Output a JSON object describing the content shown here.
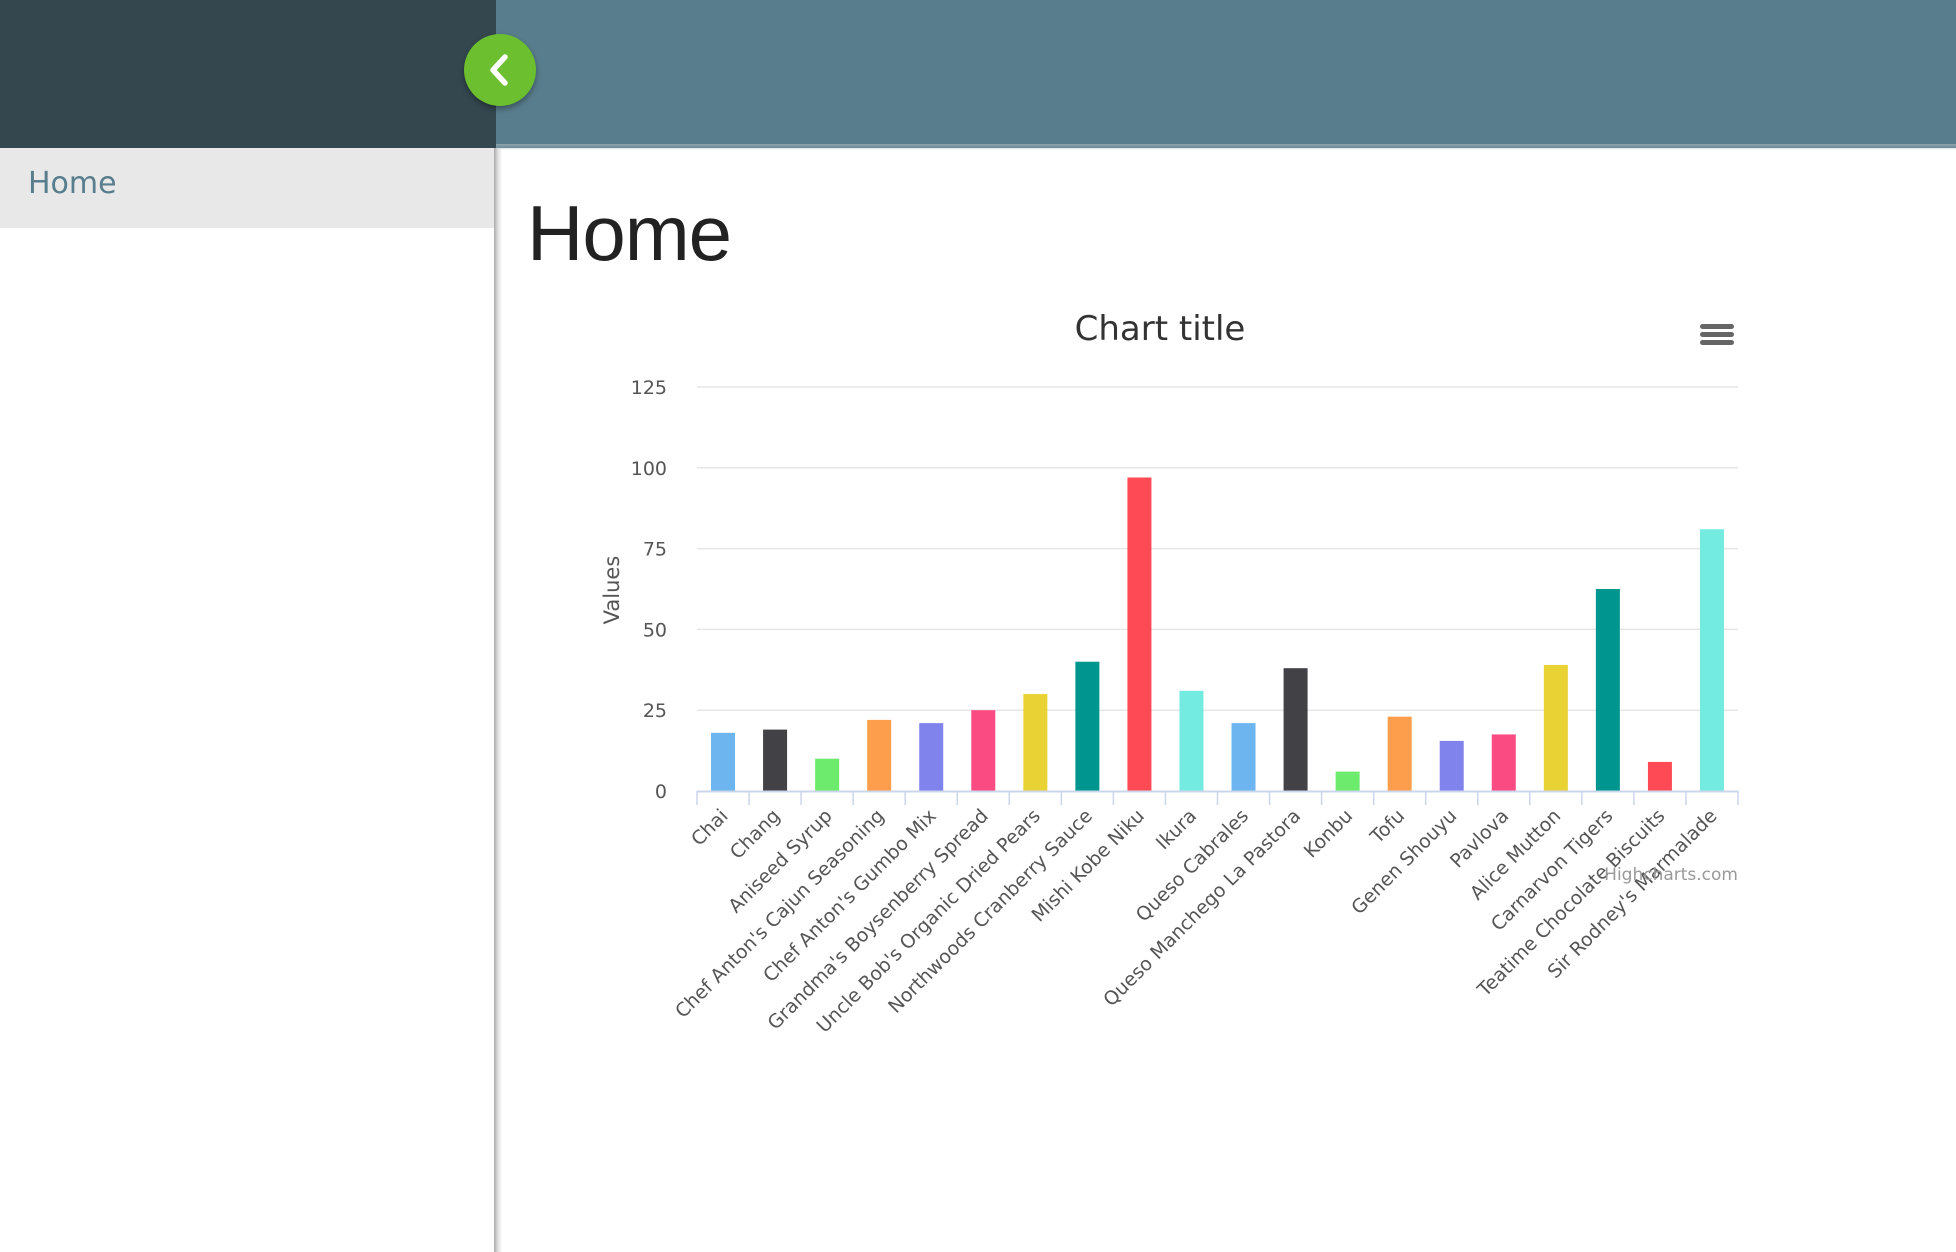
{
  "sidebar": {
    "items": [
      {
        "label": "Home"
      }
    ],
    "toggle_icon": "chevron-left-icon"
  },
  "colors": {
    "sidebar_header": "#34474f",
    "topbar": "#587d8c",
    "toggle_button": "#6cbf2f",
    "nav_active_bg": "#e8e8e8"
  },
  "main": {
    "title": "Home"
  },
  "chart_menu_icon": "hamburger-menu-icon",
  "chart_data": {
    "type": "bar",
    "title": "Chart title",
    "ylabel": "Values",
    "xlabel": "",
    "ylim": [
      0,
      125
    ],
    "yticks": [
      0,
      25,
      50,
      75,
      100,
      125
    ],
    "grid": true,
    "credits": "Highcharts.com",
    "categories": [
      "Chai",
      "Chang",
      "Aniseed Syrup",
      "Chef Anton's Cajun Seasoning",
      "Chef Anton's Gumbo Mix",
      "Grandma's Boysenberry Spread",
      "Uncle Bob's Organic Dried Pears",
      "Northwoods Cranberry Sauce",
      "Mishi Kobe Niku",
      "Ikura",
      "Queso Cabrales",
      "Queso Manchego La Pastora",
      "Konbu",
      "Tofu",
      "Genen Shouyu",
      "Pavlova",
      "Alice Mutton",
      "Carnarvon Tigers",
      "Teatime Chocolate Biscuits",
      "Sir Rodney's Marmalade"
    ],
    "values": [
      18,
      19,
      10,
      22,
      21,
      25,
      30,
      40,
      97,
      31,
      21,
      38,
      6,
      23,
      15.5,
      17.5,
      39,
      62.5,
      9,
      81
    ],
    "colors": [
      "#6db5ee",
      "#414146",
      "#6ceb6c",
      "#fd9e4c",
      "#8183ed",
      "#fb4b83",
      "#e9d233",
      "#009690",
      "#fe4a55",
      "#74ebe1",
      "#6db5ee",
      "#414146",
      "#6ceb6c",
      "#fd9e4c",
      "#8183ed",
      "#fb4b83",
      "#e9d233",
      "#009690",
      "#fe4a55",
      "#74ebe1"
    ]
  }
}
